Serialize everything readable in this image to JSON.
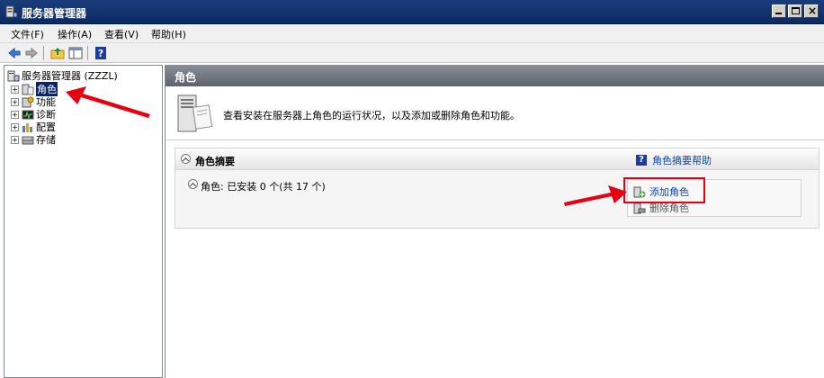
{
  "window": {
    "title": "服务器管理器"
  },
  "menu": [
    {
      "label": "文件(F)"
    },
    {
      "label": "操作(A)"
    },
    {
      "label": "查看(V)"
    },
    {
      "label": "帮助(H)"
    }
  ],
  "tree": {
    "root": "服务器管理器 (ZZZL)",
    "items": [
      {
        "label": "角色",
        "selected": true
      },
      {
        "label": "功能"
      },
      {
        "label": "诊断"
      },
      {
        "label": "配置"
      },
      {
        "label": "存储"
      }
    ]
  },
  "main": {
    "header": "角色",
    "description": "查看安装在服务器上角色的运行状况，以及添加或删除角色和功能。",
    "summary": {
      "title": "角色摘要",
      "help_link": "角色摘要帮助",
      "status": "角色: 已安装 0 个(共 17 个)",
      "add_role": "添加角色",
      "remove_role": "删除角色"
    }
  },
  "colors": {
    "title_bar": "#0b2a64",
    "selection": "#0a246a",
    "annotation": "#e60012",
    "link": "#0645ad"
  }
}
